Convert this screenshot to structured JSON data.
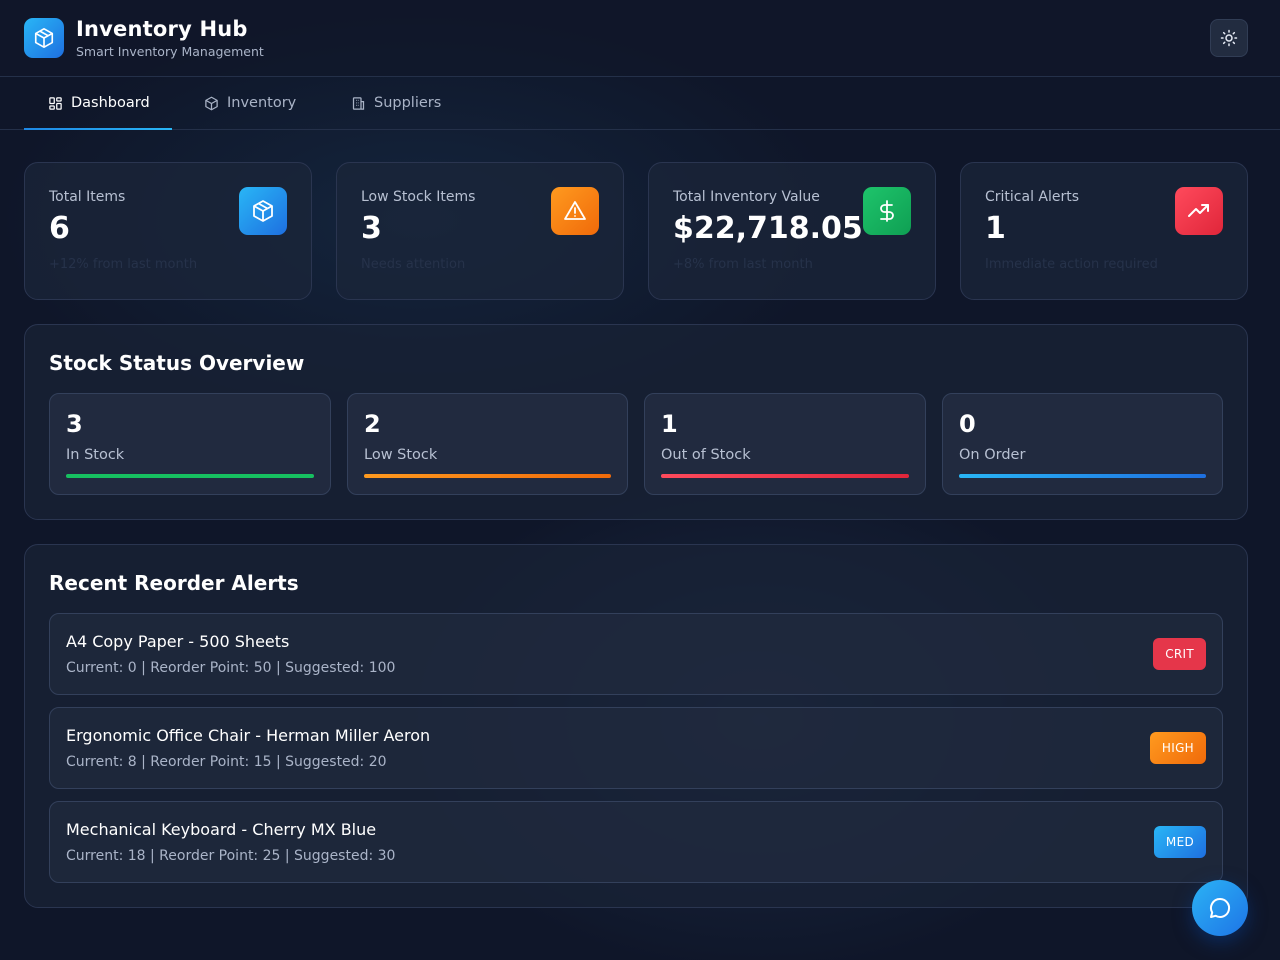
{
  "app": {
    "title": "Inventory Hub",
    "subtitle": "Smart Inventory Management",
    "logo_icon": "cube-icon",
    "theme_toggle_icon": "sun-icon"
  },
  "tabs": [
    {
      "label": "Dashboard",
      "icon": "grid-icon",
      "active": true
    },
    {
      "label": "Inventory",
      "icon": "cube-icon",
      "active": false
    },
    {
      "label": "Suppliers",
      "icon": "building-icon",
      "active": false
    }
  ],
  "stats": [
    {
      "label": "Total Items",
      "value": "6",
      "note": "+12% from last month",
      "icon": "cube-icon",
      "color": "#1e88e5"
    },
    {
      "label": "Low Stock Items",
      "value": "3",
      "note": "Needs attention",
      "icon": "warning-icon",
      "color": "#f57c00"
    },
    {
      "label": "Total Inventory Value",
      "value": "$22,718.05",
      "note": "+8% from last month",
      "icon": "dollar-icon",
      "color": "#16a34a"
    },
    {
      "label": "Critical Alerts",
      "value": "1",
      "note": "Immediate action required",
      "icon": "trending-up-icon",
      "color": "#e5364a"
    }
  ],
  "stock_overview": {
    "title": "Stock Status Overview",
    "items": [
      {
        "count": "3",
        "label": "In Stock",
        "color": "#16c060"
      },
      {
        "count": "2",
        "label": "Low Stock",
        "color": "#f57c00"
      },
      {
        "count": "1",
        "label": "Out of Stock",
        "color": "#e5364a"
      },
      {
        "count": "0",
        "label": "On Order",
        "color": "#1e88e5"
      }
    ]
  },
  "reorder_alerts": {
    "title": "Recent Reorder Alerts",
    "items": [
      {
        "name": "A4 Copy Paper - 500 Sheets",
        "details": "Current: 0 | Reorder Point: 50 | Suggested: 100",
        "priority": "CRIT"
      },
      {
        "name": "Ergonomic Office Chair - Herman Miller Aeron",
        "details": "Current: 8 | Reorder Point: 15 | Suggested: 20",
        "priority": "HIGH"
      },
      {
        "name": "Mechanical Keyboard - Cherry MX Blue",
        "details": "Current: 18 | Reorder Point: 25 | Suggested: 30",
        "priority": "MED"
      }
    ]
  },
  "chat_button": {
    "icon": "chat-bubble-icon"
  }
}
